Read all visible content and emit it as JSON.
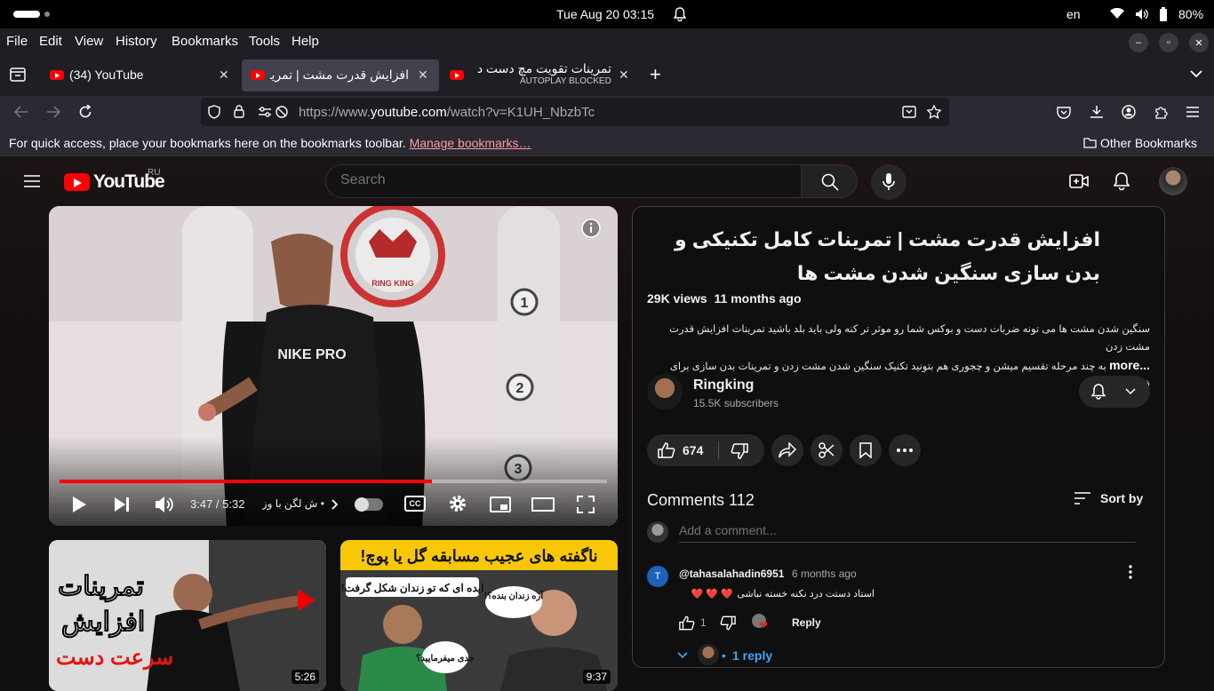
{
  "os": {
    "clock": "Tue Aug 20  03:15",
    "lang": "en",
    "battery": "80%"
  },
  "menu": {
    "items": [
      "File",
      "Edit",
      "View",
      "History",
      "Bookmarks",
      "Tools",
      "Help"
    ]
  },
  "tabs": [
    {
      "title": "(34) YouTube",
      "sub": ""
    },
    {
      "title": "افزایش قدرت مشت | تمرینات",
      "sub": ""
    },
    {
      "title": "تمرینات تقویت مچ دست د",
      "sub": "AUTOPLAY BLOCKED"
    }
  ],
  "url": {
    "prefix": "https://www.",
    "host": "youtube.com",
    "path": "/watch?v=K1UH_NbzbTc"
  },
  "bookmarks": {
    "message": "For quick access, place your bookmarks here on the bookmarks toolbar.",
    "manage_link": "Manage bookmarks…",
    "other": "Other Bookmarks"
  },
  "yt": {
    "logo": "YouTube",
    "country": "RU",
    "search_placeholder": "Search"
  },
  "player": {
    "time": "3:47 / 5:32",
    "chapter": "• ش لگن با وزنه",
    "progress": 0.68,
    "shirt_text": "NIKE PRO",
    "ring_text": "RING KING"
  },
  "recs": [
    {
      "duration": "5:26",
      "line1": "تمرینات",
      "line2": "افزایش",
      "line3": "سرعت دست"
    },
    {
      "duration": "9:37",
      "banner": "ناگفته های عجیب مسابقه گل یا پوچ!",
      "bubble1": "ایده ای که تو زندان شکل گرفت!",
      "bubble2": "آره زندان بنده؟!",
      "bubble3": "جدی میفرمایید؟"
    }
  ],
  "video": {
    "title": "افزایش قدرت مشت | تمرینات کامل تکنیکی و بدن سازی سنگین شدن مشت ها",
    "views": "29K views",
    "age": "11 months ago",
    "desc_line1": "سنگین شدن مشت ها می تونه ضربات دست و بوکس شما رو موثر تر کنه ولی باید بلد باشید تمرینات افزایش قدرت مشت زدن",
    "desc_line2": "به چند مرحله تقسیم میشن و چجوری هم بتونید تکنیک سنگین شدن مشت زدن و تمرینات بدن سازی برای قدرت مشت رو",
    "more": "...more"
  },
  "channel": {
    "name": "Ringking",
    "subs": "15.5K subscribers"
  },
  "actions": {
    "likes": "674"
  },
  "comments": {
    "title": "Comments 112",
    "sort": "Sort by",
    "add_placeholder": "Add a comment...",
    "item": {
      "avatar_letter": "T",
      "author": "@tahasalahadin6951",
      "time": "6 months ago",
      "text": "استاد دستت درد نکنه خسته نباشی",
      "hearts": "❤️ ❤️ ❤️",
      "likes": "1",
      "reply": "Reply",
      "replies": "1 reply"
    }
  },
  "colors": {
    "accent_red": "#ff0000",
    "link_blue": "#3ea6ff",
    "bookmark_link": "#ff9aa2"
  }
}
